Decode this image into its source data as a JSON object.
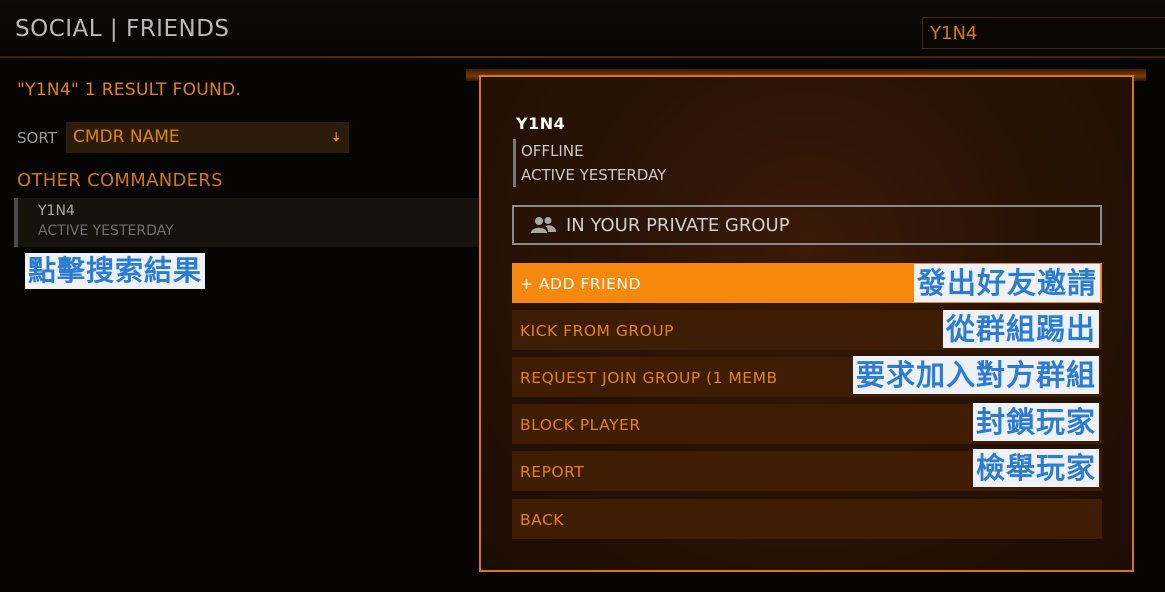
{
  "header": {
    "title": "SOCIAL | FRIENDS",
    "search_value": "Y1N4"
  },
  "left": {
    "result_text": "\"Y1N4\" 1 RESULT FOUND.",
    "sort_label": "SORT",
    "sort_value": "CMDR NAME",
    "section_title": "OTHER COMMANDERS",
    "commander": {
      "name": "Y1N4",
      "status": "ACTIVE YESTERDAY"
    },
    "annotation": "點擊搜索結果"
  },
  "panel": {
    "player_name": "Y1N4",
    "status_lines": [
      "OFFLINE",
      "ACTIVE YESTERDAY"
    ],
    "group_text": "IN YOUR PRIVATE GROUP",
    "actions": [
      {
        "label": "+ ADD FRIEND",
        "annotation": "發出好友邀請"
      },
      {
        "label": "KICK FROM GROUP",
        "annotation": "從群組踢出"
      },
      {
        "label": "REQUEST JOIN GROUP (1 MEMB",
        "annotation": "要求加入對方群組"
      },
      {
        "label": "BLOCK PLAYER",
        "annotation": "封鎖玩家"
      },
      {
        "label": "REPORT",
        "annotation": "檢舉玩家"
      },
      {
        "label": "BACK"
      }
    ]
  },
  "colors": {
    "accent": "#e3820f",
    "active_button": "#f5880d",
    "annotation_text": "#2c7cd4"
  },
  "icons": {
    "group": "users-icon",
    "sort_arrow": "arrow-down-icon"
  }
}
